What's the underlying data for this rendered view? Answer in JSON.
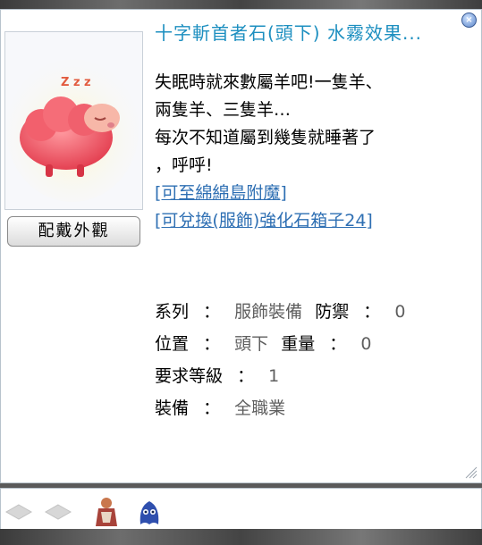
{
  "window": {
    "title": "十字斬首者石(頭下) 水霧效果...",
    "close_icon": "close-icon"
  },
  "preview": {
    "image": "sleeping-pink-sheep-icon",
    "sleep_text": "Z z z",
    "appearance_button": "配戴外觀"
  },
  "description": {
    "lines": [
      "失眠時就來數屬羊吧!一隻羊、",
      "兩隻羊、三隻羊…",
      "每次不知道屬到幾隻就睡著了",
      "，呼呼!"
    ],
    "links": [
      "[可至綿綿島附魔]",
      "[可兌換(服飾)強化石箱子24]"
    ]
  },
  "stats": {
    "series_label": "系列",
    "series_value": "服飾裝備",
    "defense_label": "防禦",
    "defense_value": "0",
    "position_label": "位置",
    "position_value": "頭下",
    "weight_label": "重量",
    "weight_value": "0",
    "level_label": "要求等級",
    "level_value": "1",
    "job_label": "裝備",
    "job_value": "全職業",
    "colon": "："
  },
  "item_bar": {
    "slots": [
      "empty-slot-icon",
      "empty-slot-icon",
      "character-figure-icon",
      "blue-ghost-pet-icon"
    ]
  },
  "colors": {
    "title": "#1d8fc0",
    "link": "#2e6fb3",
    "value_gray": "#5f5f5f"
  }
}
